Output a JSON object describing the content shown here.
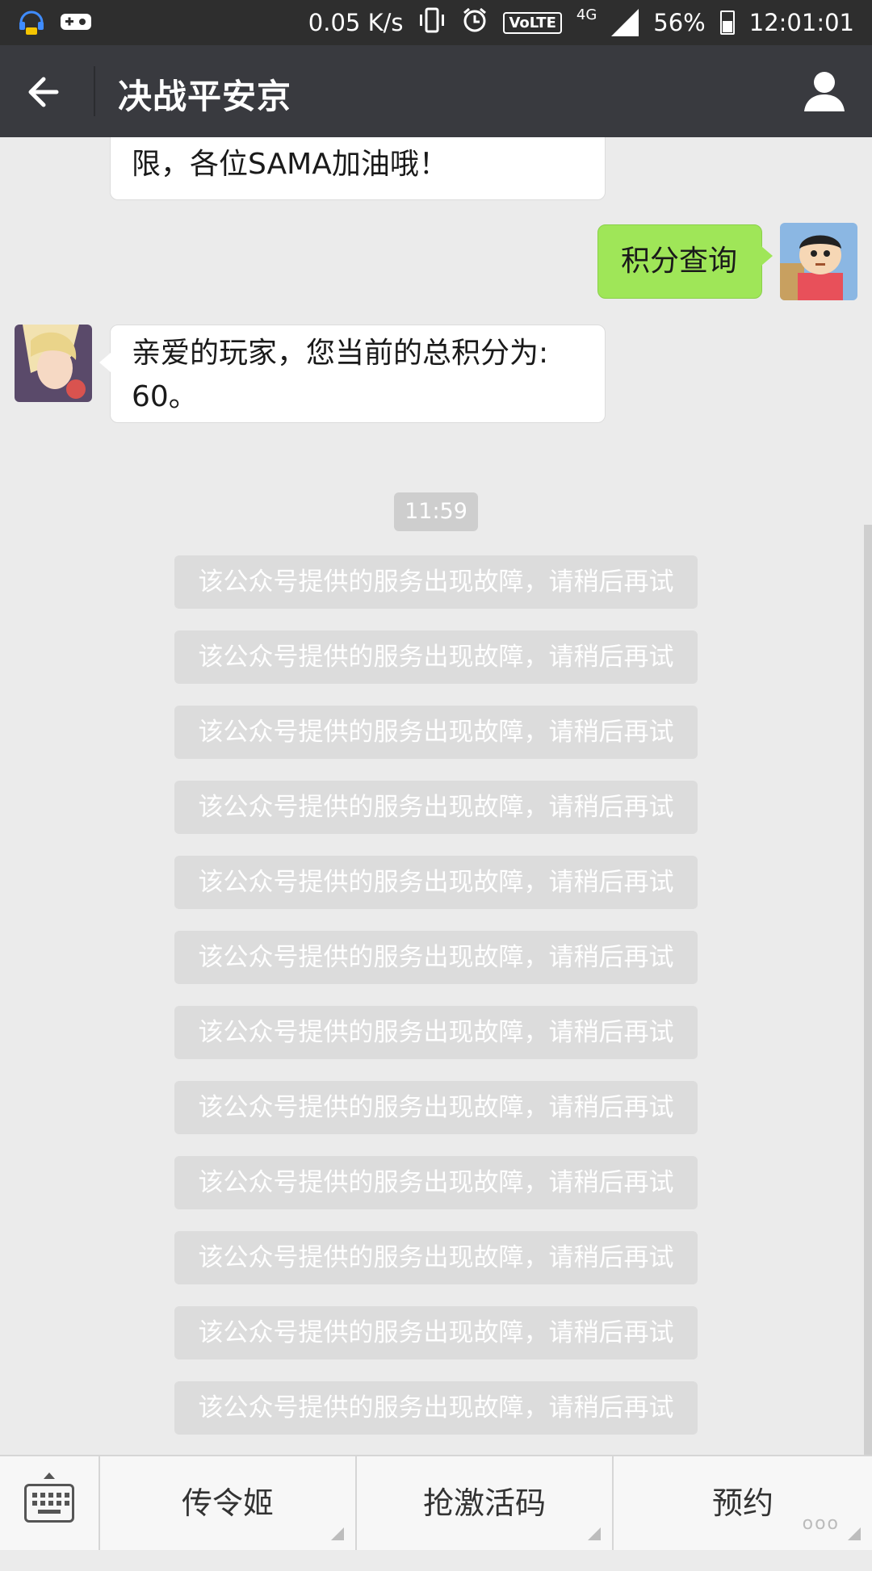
{
  "status_bar": {
    "net_speed": "0.05 K/s",
    "network": "4G",
    "volte": "VoLTE",
    "battery": "56%",
    "time": "12:01:01"
  },
  "header": {
    "title": "决战平安京"
  },
  "messages": [
    {
      "side": "left",
      "text": "限，各位SAMA加油哦！"
    },
    {
      "side": "right",
      "text": "积分查询"
    },
    {
      "side": "left",
      "text_line1": "亲爱的玩家，您当前的总积分为:",
      "text_line2": "60。"
    }
  ],
  "timestamp": "11:59",
  "system_messages": [
    "该公众号提供的服务出现故障，请稍后再试",
    "该公众号提供的服务出现故障，请稍后再试",
    "该公众号提供的服务出现故障，请稍后再试",
    "该公众号提供的服务出现故障，请稍后再试",
    "该公众号提供的服务出现故障，请稍后再试",
    "该公众号提供的服务出现故障，请稍后再试",
    "该公众号提供的服务出现故障，请稍后再试",
    "该公众号提供的服务出现故障，请稍后再试",
    "该公众号提供的服务出现故障，请稍后再试",
    "该公众号提供的服务出现故障，请稍后再试",
    "该公众号提供的服务出现故障，请稍后再试",
    "该公众号提供的服务出现故障，请稍后再试"
  ],
  "menu": {
    "items": [
      "传令姬",
      "抢激活码",
      "预约"
    ],
    "more": "ooo"
  },
  "colors": {
    "status_bg": "#2e2e2e",
    "titlebar_bg": "#393a3f",
    "chat_bg": "#ebebeb",
    "bubble_out": "#9fe658",
    "system_chip": "#dcdcdc"
  }
}
